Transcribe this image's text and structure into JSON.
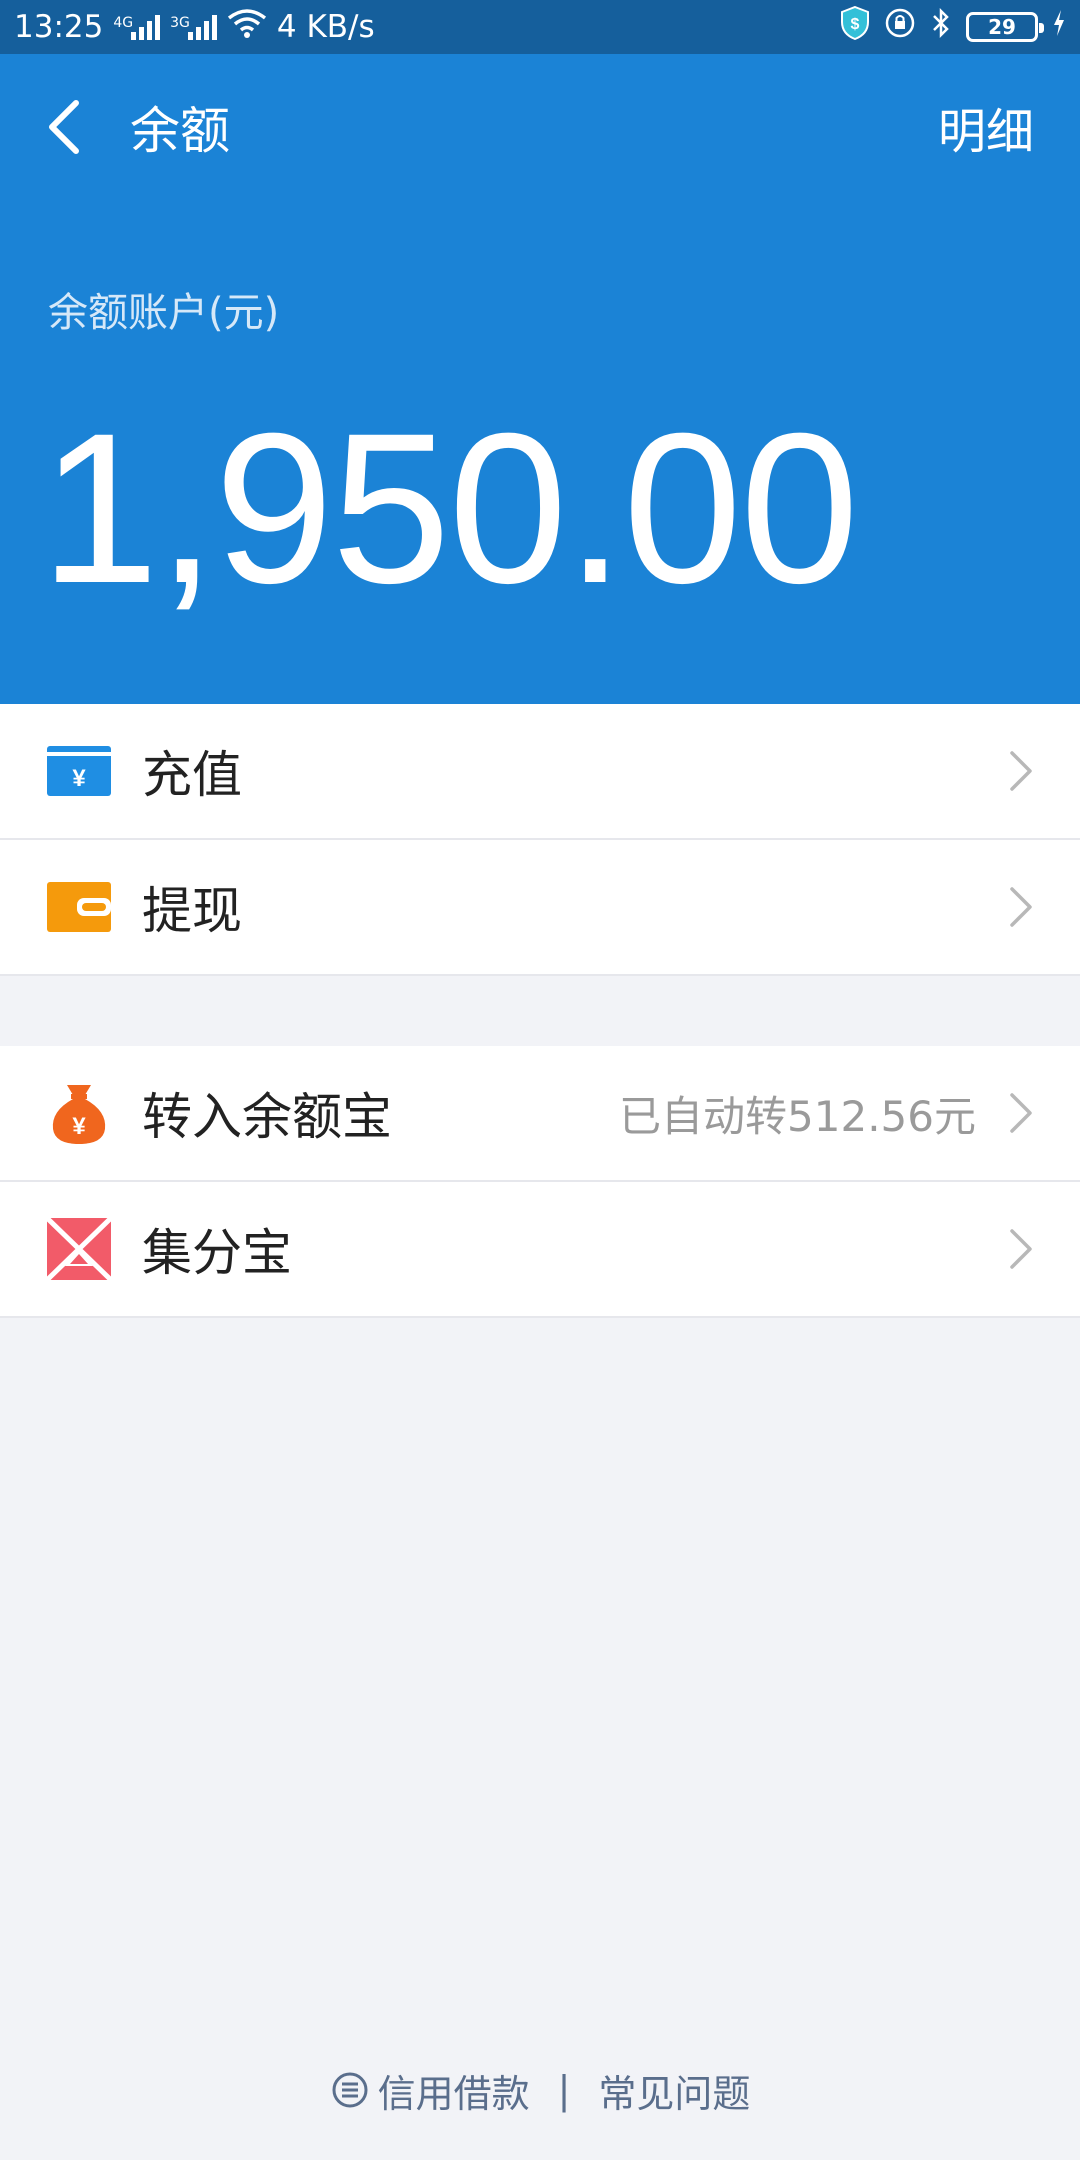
{
  "status_bar": {
    "time": "13:25",
    "net1": "4G",
    "net2": "3G",
    "speed": "4 KB/s",
    "battery": "29"
  },
  "header": {
    "title": "余额",
    "detail_label": "明细",
    "account_label": "余额账户(元)",
    "balance": "1,950.00"
  },
  "menu_group_1": [
    {
      "label": "充值",
      "icon": "recharge-card-icon"
    },
    {
      "label": "提现",
      "icon": "wallet-icon"
    }
  ],
  "menu_group_2": [
    {
      "label": "转入余额宝",
      "value": "已自动转512.56元",
      "icon": "money-bag-icon"
    },
    {
      "label": "集分宝",
      "icon": "jifenbao-icon"
    }
  ],
  "footer": {
    "left_link": "信用借款",
    "separator": "|",
    "right_link": "常见问题"
  },
  "colors": {
    "header_bg": "#1b83d6",
    "status_bg": "#155f9c",
    "recharge_icon": "#1f8ee3",
    "wallet_icon": "#f59a0c",
    "bag_icon": "#f0661e",
    "jifenbao_icon": "#f25b69"
  }
}
